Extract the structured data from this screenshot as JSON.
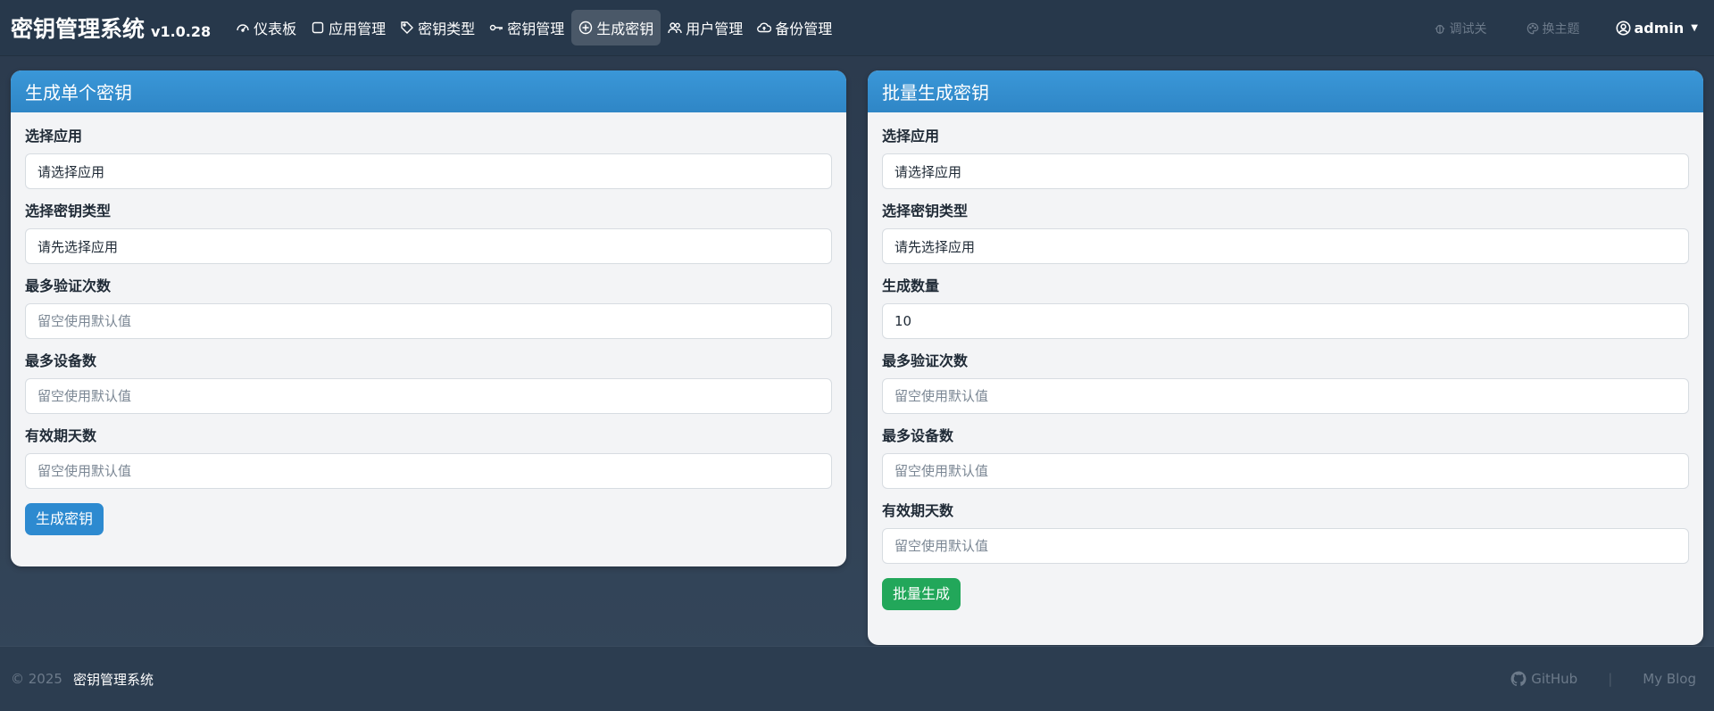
{
  "brand": {
    "title": "密钥管理系统",
    "version": "v1.0.28"
  },
  "nav": {
    "items": [
      {
        "label": "仪表板",
        "icon": "dashboard-icon"
      },
      {
        "label": "应用管理",
        "icon": "square-icon"
      },
      {
        "label": "密钥类型",
        "icon": "tag-icon"
      },
      {
        "label": "密钥管理",
        "icon": "key-icon"
      },
      {
        "label": "生成密钥",
        "icon": "plus-circle-icon",
        "active": true
      },
      {
        "label": "用户管理",
        "icon": "users-icon"
      },
      {
        "label": "备份管理",
        "icon": "cloud-upload-icon"
      }
    ],
    "debug_label": "调试关",
    "theme_label": "换主题",
    "user_label": "admin"
  },
  "single": {
    "title": "生成单个密钥",
    "app_label": "选择应用",
    "app_value": "请选择应用",
    "type_label": "选择密钥类型",
    "type_value": "请先选择应用",
    "max_verify_label": "最多验证次数",
    "max_verify_placeholder": "留空使用默认值",
    "max_devices_label": "最多设备数",
    "max_devices_placeholder": "留空使用默认值",
    "valid_days_label": "有效期天数",
    "valid_days_placeholder": "留空使用默认值",
    "submit_label": "生成密钥"
  },
  "batch": {
    "title": "批量生成密钥",
    "app_label": "选择应用",
    "app_value": "请选择应用",
    "type_label": "选择密钥类型",
    "type_value": "请先选择应用",
    "count_label": "生成数量",
    "count_value": "10",
    "max_verify_label": "最多验证次数",
    "max_verify_placeholder": "留空使用默认值",
    "max_devices_label": "最多设备数",
    "max_devices_placeholder": "留空使用默认值",
    "valid_days_label": "有效期天数",
    "valid_days_placeholder": "留空使用默认值",
    "submit_label": "批量生成"
  },
  "footer": {
    "copyright": "© 2025",
    "name": "密钥管理系统",
    "github_label": "GitHub",
    "separator": "|",
    "blog_label": "My Blog"
  },
  "colors": {
    "navbar": "#27384b",
    "card_header": "#2f86c6",
    "primary_button": "#2d8ad0",
    "success_button": "#22a75a"
  }
}
